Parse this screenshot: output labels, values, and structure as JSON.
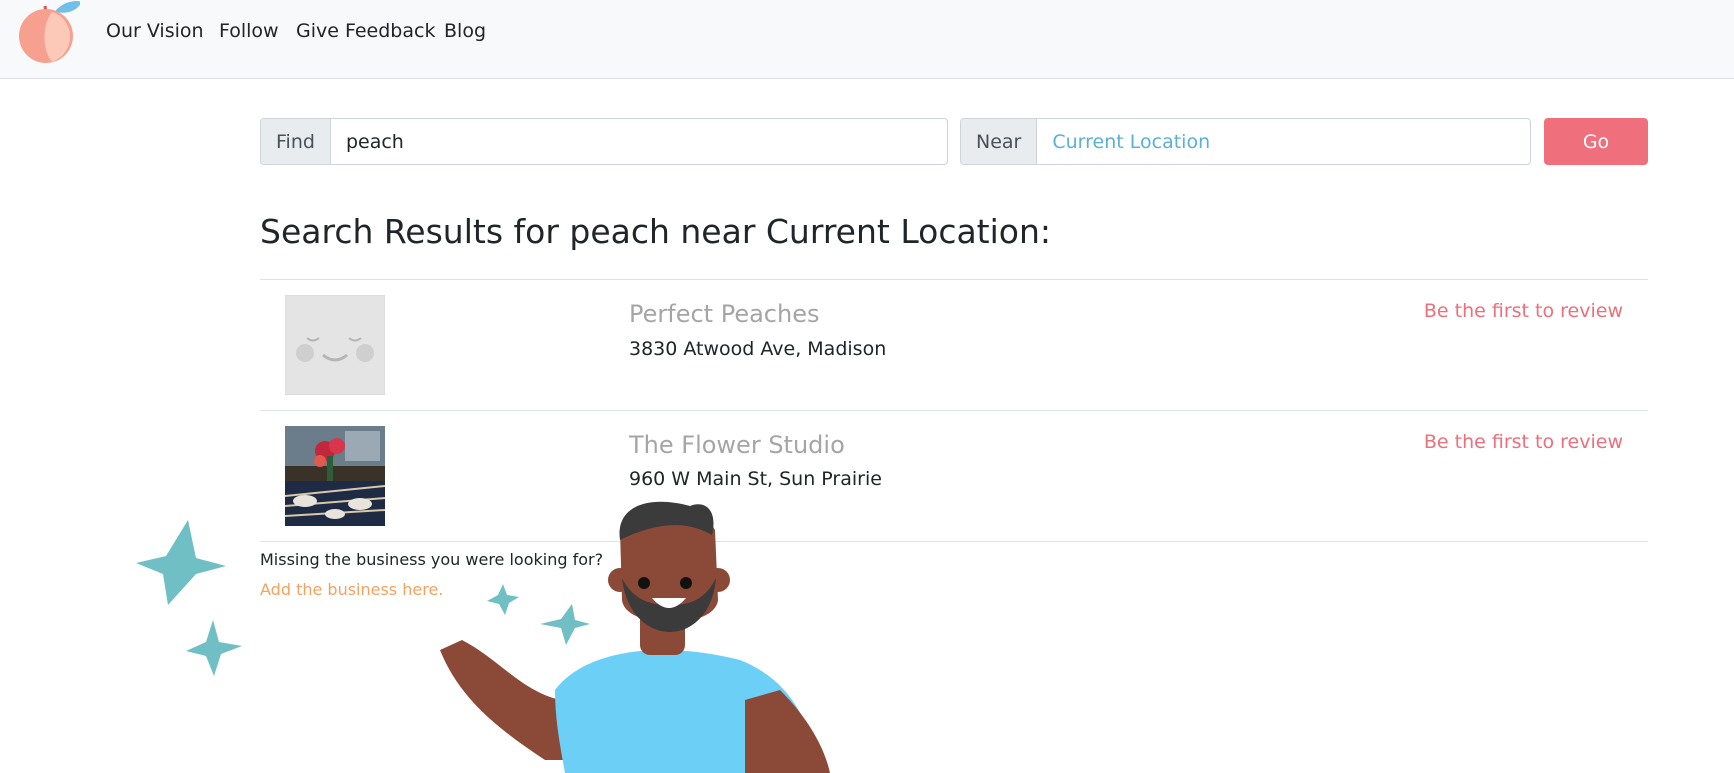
{
  "nav": {
    "items": [
      {
        "label": "Our Vision"
      },
      {
        "label": "Follow"
      },
      {
        "label": "Give Feedback"
      },
      {
        "label": "Blog"
      }
    ]
  },
  "search": {
    "find_label": "Find",
    "find_value": "peach",
    "near_label": "Near",
    "near_placeholder": "Current Location",
    "go_label": "Go"
  },
  "results": {
    "title": "Search Results for peach near Current Location:",
    "items": [
      {
        "name": "Perfect Peaches",
        "address": "3830 Atwood Ave, Madison",
        "review_link": "Be the first to review",
        "thumb": "placeholder-face"
      },
      {
        "name": "The Flower Studio",
        "address": "960 W Main St, Sun Prairie",
        "review_link": "Be the first to review",
        "thumb": "photo-table-flowers"
      }
    ],
    "missing_text": "Missing the business you were looking for?",
    "add_link": "Add the business here."
  },
  "colors": {
    "brand_peach": "#f7a08f",
    "accent_red": "#ef6f7c",
    "link_orange": "#f4a261",
    "star_teal": "#6fbfc4",
    "shirt_blue": "#6ccff6"
  },
  "icons": [
    "peach-logo-icon",
    "star-icon"
  ]
}
